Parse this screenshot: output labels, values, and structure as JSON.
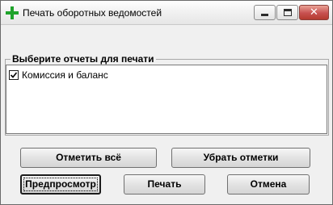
{
  "window": {
    "title": "Печать оборотных ведомостей",
    "icon": "green-plus-icon",
    "controls": {
      "minimize": "minimize-icon",
      "maximize": "maximize-icon",
      "close_glyph": "✕"
    }
  },
  "report_group": {
    "label": "Выберите отчеты для печати",
    "items": [
      {
        "label": "Комиссия и баланс",
        "checked": true
      }
    ]
  },
  "buttons": {
    "select_all": "Отметить всё",
    "clear_marks": "Убрать отметки",
    "preview": "Предпросмотр",
    "print": "Печать",
    "cancel": "Отмена"
  },
  "colors": {
    "icon_green": "#1fa32b",
    "close_red": "#c75050"
  }
}
